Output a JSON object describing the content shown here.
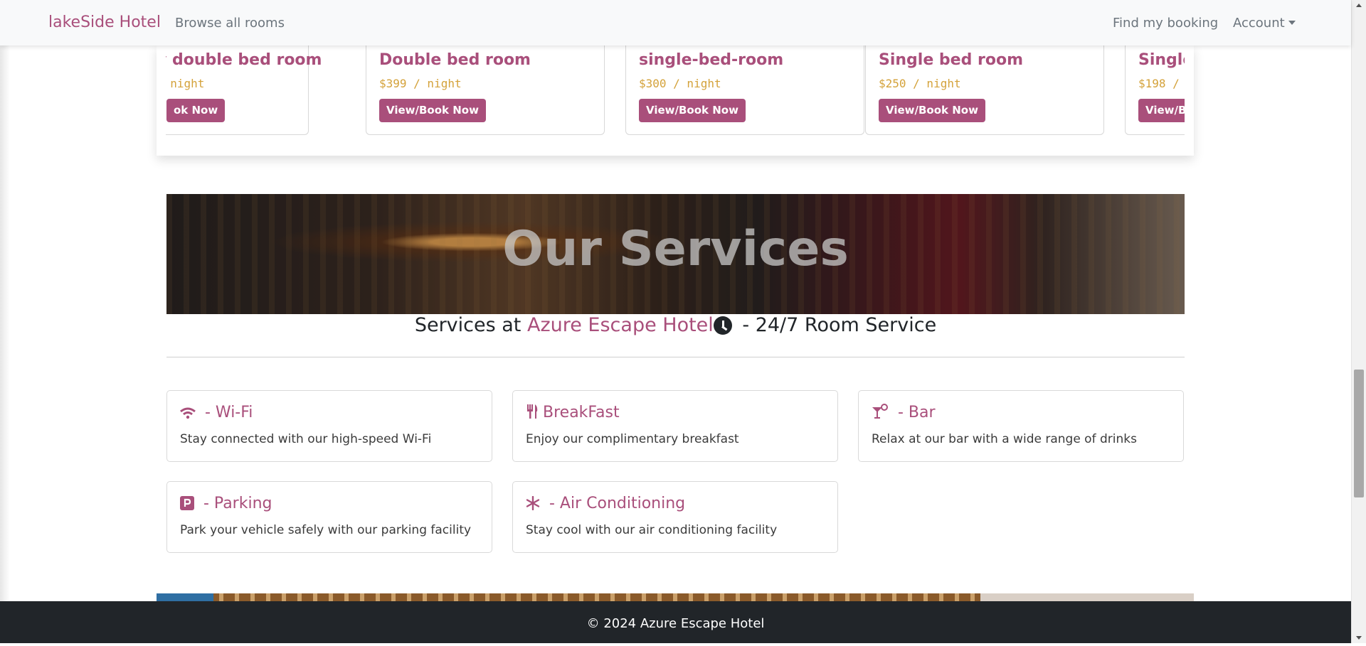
{
  "navbar": {
    "brand": "lakeSide Hotel",
    "browse": "Browse all rooms",
    "find_booking": "Find my booking",
    "account": "Account"
  },
  "rooms": [
    {
      "name": "y double bed room",
      "price": "$ night",
      "button": "ok Now"
    },
    {
      "name": "Double bed room",
      "price": "$399 / night",
      "button": "View/Book Now"
    },
    {
      "name": "single-bed-room",
      "price": "$300 / night",
      "button": "View/Book Now"
    },
    {
      "name": "Single bed room",
      "price": "$250 / night",
      "button": "View/Book Now"
    },
    {
      "name": "Single",
      "price": "$198 /",
      "button": "View/Bo"
    }
  ],
  "services_section": {
    "banner_title": "Our Services",
    "subtitle_prefix": "Services at ",
    "hotel_name": "Azure Escape Hotel",
    "subtitle_suffix": " - 24/7 Room Service"
  },
  "services": [
    {
      "title": " - Wi-Fi",
      "desc": "Stay connected with our high-speed Wi-Fi",
      "icon": "wifi-icon"
    },
    {
      "title": "BreakFast",
      "desc": "Enjoy our complimentary breakfast",
      "icon": "utensils-icon"
    },
    {
      "title": " - Bar",
      "desc": "Relax at our bar with a wide range of drinks",
      "icon": "cocktail-icon"
    },
    {
      "title": " - Parking",
      "desc": "Park your vehicle safely with our parking facility",
      "icon": "parking-icon"
    },
    {
      "title": " - Air Conditioning",
      "desc": "Stay cool with our air conditioning facility",
      "icon": "snowflake-icon"
    }
  ],
  "footer": {
    "text": "© 2024 Azure Escape Hotel"
  },
  "colors": {
    "accent": "#a94f7b",
    "price": "#d4a23a",
    "footer_bg": "#212529"
  }
}
